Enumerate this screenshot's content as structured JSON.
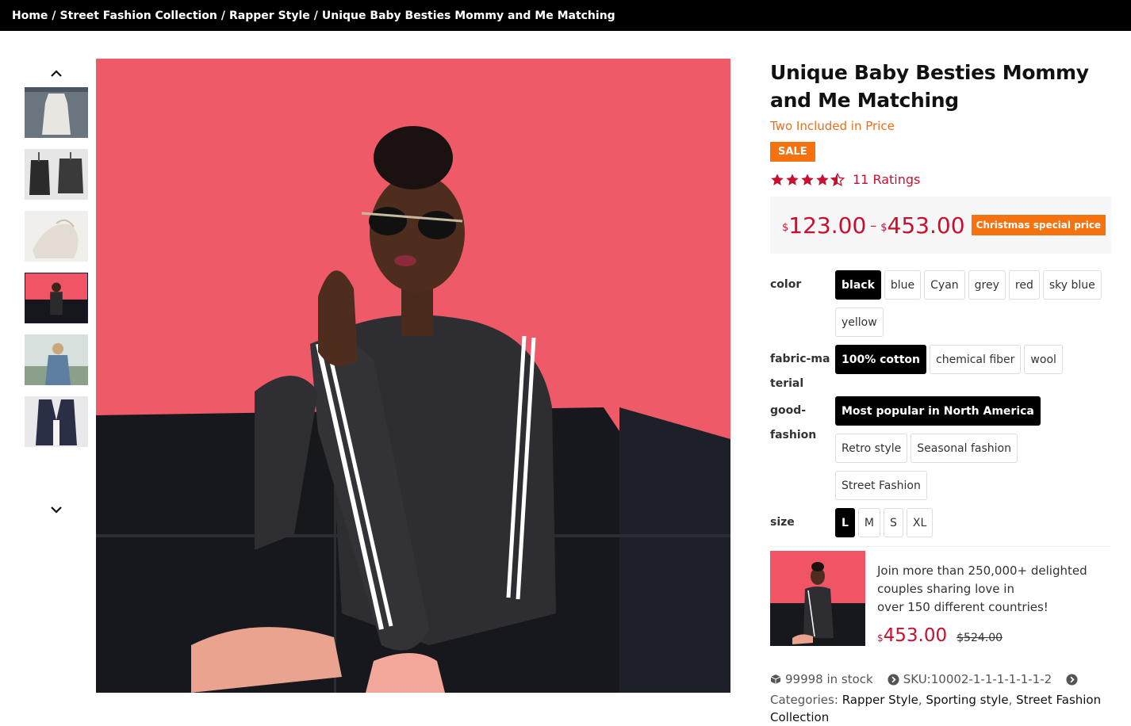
{
  "breadcrumb": {
    "items": [
      "Home",
      "Street Fashion Collection",
      "Rapper Style",
      "Unique Baby Besties Mommy and Me Matching"
    ],
    "separator": "/"
  },
  "gallery": {
    "up_icon": "chevron-up-icon",
    "down_icon": "chevron-down-icon",
    "thumbnails": [
      {
        "alt": "white-dress-thumbnail"
      },
      {
        "alt": "black-garments-thumbnail"
      },
      {
        "alt": "white-bag-thumbnail"
      },
      {
        "alt": "woman-on-red-thumbnail",
        "active": true
      },
      {
        "alt": "woman-outdoors-thumbnail"
      },
      {
        "alt": "dark-vest-thumbnail"
      }
    ]
  },
  "product": {
    "title": "Unique Baby Besties Mommy and Me Matching",
    "subtitle": "Two Included in Price",
    "sale_badge": "SALE",
    "rating": 4.5,
    "ratings_text": "11 Ratings",
    "price": {
      "currency": "$",
      "min": "123.00",
      "separator": "–",
      "max": "453.00",
      "promo_badge": "Christmas special price"
    },
    "attributes": [
      {
        "label": "color",
        "options": [
          "black",
          "blue",
          "Cyan",
          "grey",
          "red",
          "sky blue",
          "yellow"
        ],
        "selected": "black"
      },
      {
        "label": "fabric-material",
        "options": [
          "100% cotton",
          "chemical fiber",
          "wool"
        ],
        "selected": "100% cotton"
      },
      {
        "label": "good-fashion",
        "options": [
          "Most popular in North America",
          "Retro style",
          "Seasonal fashion",
          "Street Fashion"
        ],
        "selected": "Most popular in North America"
      },
      {
        "label": "size",
        "options": [
          "L",
          "M",
          "S",
          "XL"
        ],
        "selected": "L"
      }
    ]
  },
  "promo_card": {
    "text_line1": "Join more than 250,000+ delighted",
    "text_line2": "couples sharing love in",
    "text_line3": "over 150 different countries!",
    "currency": "$",
    "price_now": "453.00",
    "price_was": "$524.00"
  },
  "meta": {
    "stock_text": "99998 in stock",
    "sku_text": "SKU:10002-1-1-1-1-1-1-2",
    "categories_label": "Categories:",
    "categories": [
      "Rapper Style",
      "Sporting style",
      "Street Fashion Collection"
    ]
  },
  "colors": {
    "accent_red": "#c8102e",
    "sale_orange": "#f5720f",
    "subtitle_orange": "#e8701c",
    "topbar_bg": "#000000",
    "photo_bg": "#ef5565"
  }
}
